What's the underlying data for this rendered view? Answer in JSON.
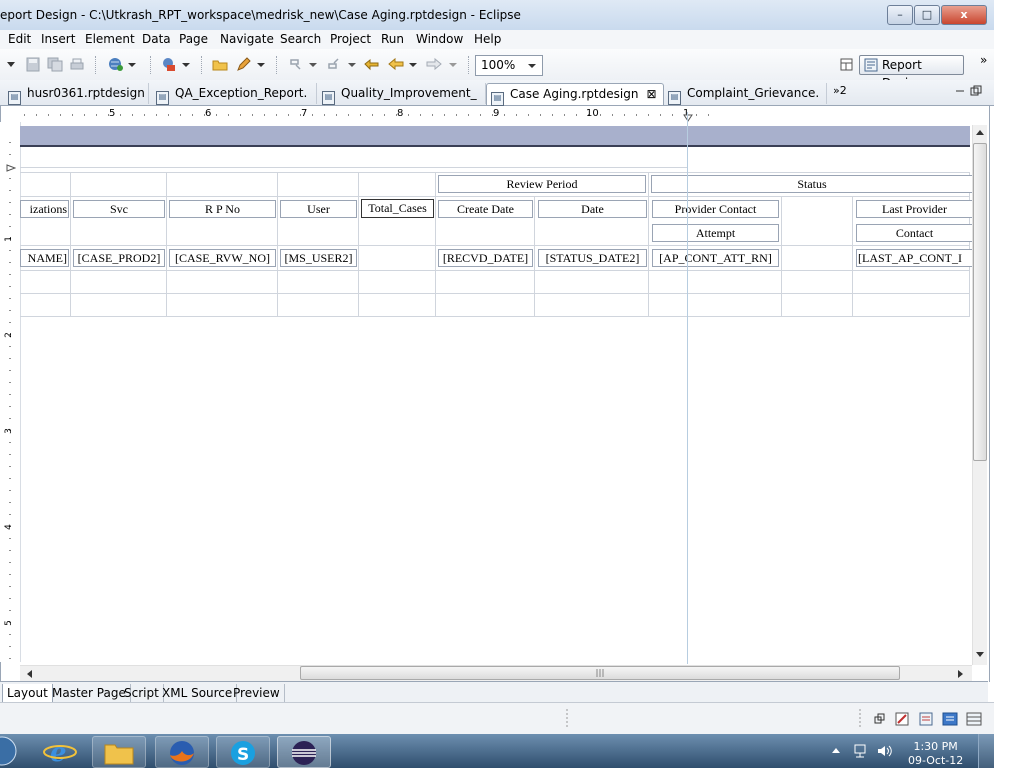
{
  "window": {
    "title": "eport Design - C:\\Utkrash_RPT_workspace\\medrisk_new\\Case Aging.rptdesign - Eclipse",
    "minimize": "–",
    "maximize": "□",
    "close": "x"
  },
  "menu": [
    "Edit",
    "Insert",
    "Element",
    "Data",
    "Page",
    "Navigate",
    "Search",
    "Project",
    "Run",
    "Window",
    "Help"
  ],
  "toolbar": {
    "zoom": "100%",
    "perspective": "Report Design",
    "overflow": "»"
  },
  "tabs": [
    {
      "label": "husr0361.rptdesign"
    },
    {
      "label": "QA_Exception_Report."
    },
    {
      "label": "Quality_Improvement_"
    },
    {
      "label": "Case Aging.rptdesign",
      "active": true,
      "close": "⊠"
    },
    {
      "label": "Complaint_Grievance."
    }
  ],
  "tabs_overflow": "»2",
  "ruler": {
    "h": [
      "5",
      "6",
      "7",
      "8",
      "9",
      "10",
      "1"
    ],
    "v": [
      "1",
      "2",
      "3",
      "4",
      "5"
    ]
  },
  "table": {
    "group_headers": {
      "review_period": "Review Period",
      "status": "Status"
    },
    "headers": {
      "orgs": "izations",
      "svc": "Svc",
      "rpno": "R P No",
      "user": "User",
      "total": "Total_Cases",
      "create": "Create Date",
      "date": "Date",
      "provider1": "Provider Contact",
      "provider2": "Attempt",
      "last1": "Last Provider",
      "last2": "Contact"
    },
    "fields": {
      "orgs": "NAME]",
      "svc": "[CASE_PROD2]",
      "rpno": "[CASE_RVW_NO]",
      "user": "[MS_USER2]",
      "create": "[RECVD_DATE]",
      "date": "[STATUS_DATE2]",
      "provider": "[AP_CONT_ATT_RN]",
      "last": "[LAST_AP_CONT_I"
    }
  },
  "bottom_tabs": [
    "Layout",
    "Master Page",
    "Script",
    "XML Source",
    "Preview"
  ],
  "clock": {
    "time": "1:30 PM",
    "date": "09-Oct-12"
  }
}
